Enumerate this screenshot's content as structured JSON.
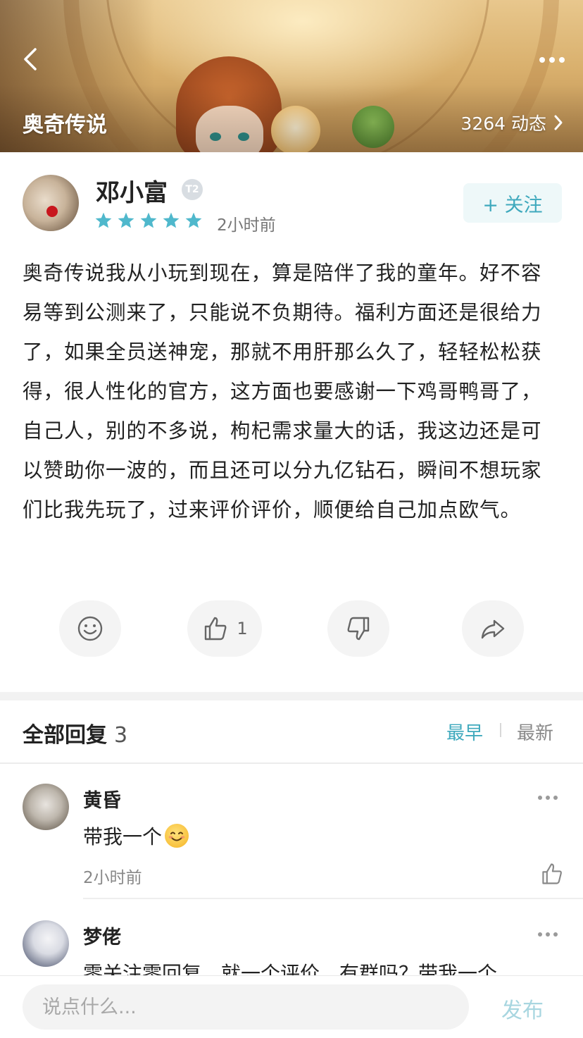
{
  "header": {
    "game_title": "奥奇传说",
    "feed_count": "3264 动态",
    "back_icon": "chevron-left-icon",
    "more_icon": "more-horizontal-icon"
  },
  "post": {
    "author": "邓小富",
    "level_badge": "T2",
    "rating": 5,
    "time": "2小时前",
    "follow_label": "+ 关注",
    "body": "奥奇传说我从小玩到现在，算是陪伴了我的童年。好不容易等到公测来了，只能说不负期待。福利方面还是很给力了，如果全员送神宠，那就不用肝那么久了，轻轻松松获得，很人性化的官方，这方面也要感谢一下鸡哥鸭哥了，自己人，别的不多说，枸杞需求量大的话，我这边还是可以赞助你一波的，而且还可以分九亿钻石，瞬间不想玩家们比我先玩了，过来评价评价，顺便给自己加点欧气。",
    "actions": {
      "like_count": "1"
    }
  },
  "replies_section": {
    "title": "全部回复",
    "count": "3",
    "sort_earliest": "最早",
    "sort_latest": "最新",
    "items": [
      {
        "name": "黄昏",
        "text": "带我一个",
        "time": "2小时前"
      },
      {
        "name": "梦佬",
        "text": "零关注零回复，就一个评价，有群吗？带我一个"
      }
    ]
  },
  "input_bar": {
    "placeholder": "说点什么...",
    "publish_label": "发布"
  },
  "colors": {
    "accent": "#3fa9bd",
    "star": "#4fb8cc",
    "publish_disabled": "#a8d6e0"
  }
}
